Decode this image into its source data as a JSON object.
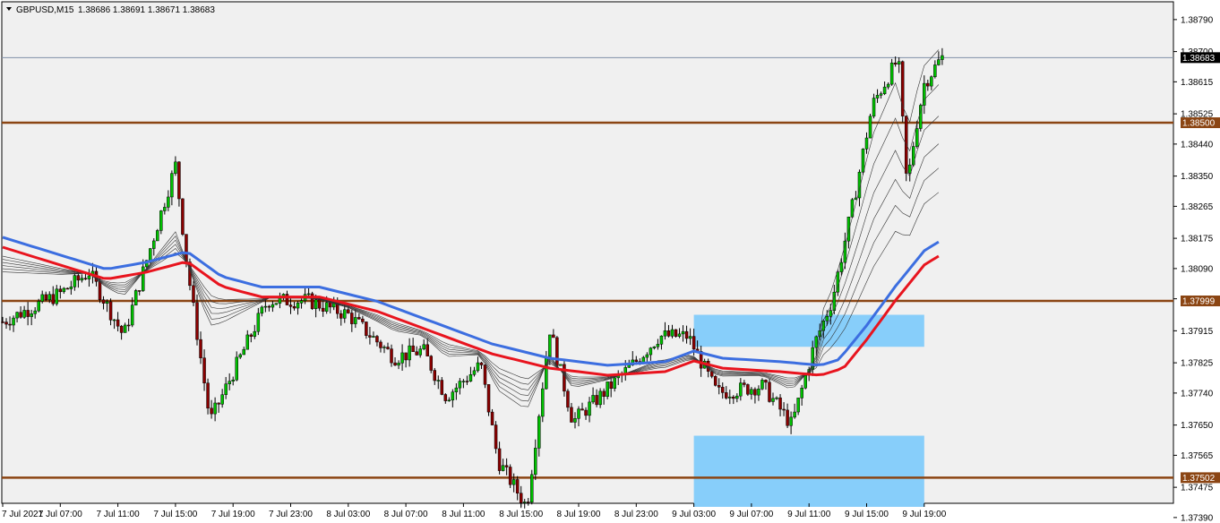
{
  "header": {
    "symbol": "GBPUSD,M15",
    "ohlc": "1.38686 1.38691 1.38671 1.38683"
  },
  "colors": {
    "background": "#f0f0f0",
    "bull": "#00c000",
    "bear": "#8b0000",
    "wick": "#000000",
    "level_line": "#8b4513",
    "ema_red": "#e8141e",
    "ema_blue": "#3c6ee0",
    "ema_thin": "#333333",
    "zone": "#87cefa",
    "current_price_line": "#8090a8"
  },
  "chart_data": {
    "type": "candlestick",
    "instrument": "GBPUSD",
    "timeframe": "M15",
    "ylim": [
      1.3743,
      1.3884
    ],
    "y_ticks": [
      "1.38790",
      "1.38700",
      "1.38615",
      "1.38525",
      "1.38440",
      "1.38350",
      "1.38265",
      "1.38175",
      "1.38090",
      "1.38005",
      "1.37915",
      "1.37825",
      "1.37740",
      "1.37650",
      "1.37565",
      "1.37475",
      "1.37390"
    ],
    "x_ticks": [
      "7 Jul 2021",
      "7 Jul 07:00",
      "7 Jul 11:00",
      "7 Jul 15:00",
      "7 Jul 19:00",
      "7 Jul 23:00",
      "8 Jul 03:00",
      "8 Jul 07:00",
      "8 Jul 11:00",
      "8 Jul 15:00",
      "8 Jul 19:00",
      "8 Jul 23:00",
      "9 Jul 03:00",
      "9 Jul 07:00",
      "9 Jul 11:00",
      "9 Jul 15:00",
      "9 Jul 19:00"
    ],
    "levels": [
      {
        "price": 1.385,
        "label": "1.38500"
      },
      {
        "price": 1.37999,
        "label": "1.37999"
      },
      {
        "price": 1.37502,
        "label": "1.37502"
      }
    ],
    "current_price": {
      "price": 1.38683,
      "label": "1.38683"
    },
    "zones": [
      {
        "x_start": 12.0,
        "x_end": 16.0,
        "price_top": 1.3796,
        "price_bottom": 1.3787
      },
      {
        "x_start": 12.0,
        "x_end": 16.0,
        "price_top": 1.3762,
        "price_bottom": 1.3742
      }
    ],
    "key_points": [
      [
        0.0,
        1.3794
      ],
      [
        1.0,
        1.3802
      ],
      [
        1.5,
        1.3808
      ],
      [
        2.1,
        1.379
      ],
      [
        3.0,
        1.3838
      ],
      [
        3.2,
        1.381
      ],
      [
        3.6,
        1.3766
      ],
      [
        4.3,
        1.379
      ],
      [
        4.6,
        1.38
      ],
      [
        5.3,
        1.38
      ],
      [
        6.0,
        1.3796
      ],
      [
        6.8,
        1.3784
      ],
      [
        7.3,
        1.3786
      ],
      [
        7.7,
        1.3773
      ],
      [
        8.3,
        1.3782
      ],
      [
        8.6,
        1.3755
      ],
      [
        9.1,
        1.3742
      ],
      [
        9.5,
        1.3792
      ],
      [
        9.9,
        1.3766
      ],
      [
        10.3,
        1.3772
      ],
      [
        11.0,
        1.3783
      ],
      [
        11.4,
        1.379
      ],
      [
        11.9,
        1.379
      ],
      [
        12.4,
        1.3774
      ],
      [
        13.2,
        1.3776
      ],
      [
        13.7,
        1.3765
      ],
      [
        14.1,
        1.3788
      ],
      [
        14.4,
        1.38
      ],
      [
        14.8,
        1.383
      ],
      [
        15.1,
        1.3855
      ],
      [
        15.55,
        1.3868
      ],
      [
        15.7,
        1.3832
      ],
      [
        15.85,
        1.3848
      ],
      [
        16.0,
        1.3861
      ],
      [
        16.3,
        1.38683
      ]
    ],
    "ema_red_points": [
      [
        0.0,
        1.3815
      ],
      [
        1.0,
        1.381
      ],
      [
        1.8,
        1.3806
      ],
      [
        2.5,
        1.3808
      ],
      [
        3.2,
        1.3811
      ],
      [
        3.8,
        1.3804
      ],
      [
        4.5,
        1.3801
      ],
      [
        5.5,
        1.3801
      ],
      [
        6.5,
        1.3797
      ],
      [
        7.5,
        1.3791
      ],
      [
        8.5,
        1.3785
      ],
      [
        9.5,
        1.3781
      ],
      [
        10.5,
        1.3779
      ],
      [
        11.5,
        1.378
      ],
      [
        12.0,
        1.3783
      ],
      [
        12.5,
        1.3781
      ],
      [
        13.5,
        1.378
      ],
      [
        14.2,
        1.3779
      ],
      [
        14.6,
        1.3781
      ],
      [
        15.0,
        1.3789
      ],
      [
        15.5,
        1.38
      ],
      [
        16.0,
        1.381
      ],
      [
        16.3,
        1.3813
      ]
    ],
    "ema_blue_offset": 0.0004
  }
}
